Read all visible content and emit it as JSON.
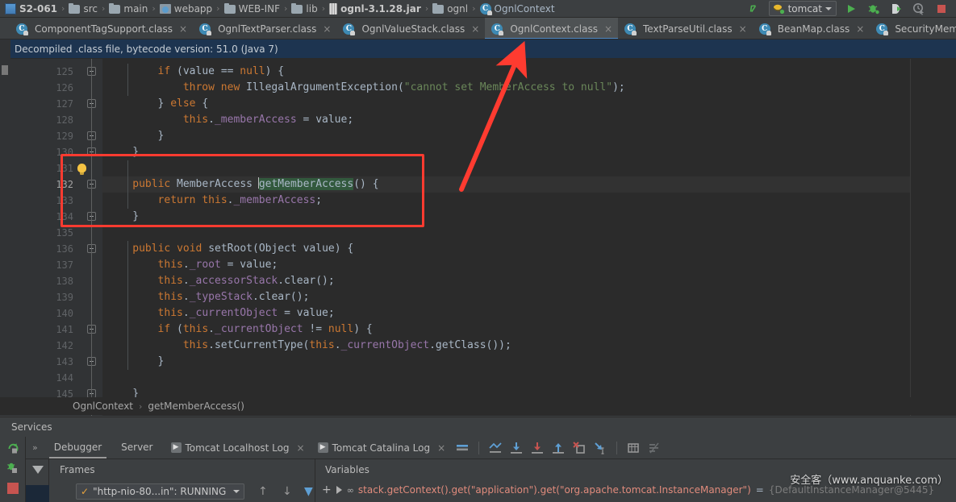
{
  "window": {
    "theme_bg": "#3c3f41",
    "editor_bg": "#2b2b2b",
    "accent": "#4a88c7",
    "annotation_color": "#ff3b30"
  },
  "navbar": {
    "breadcrumbs": [
      {
        "label": "S2-061",
        "icon": "module-icon",
        "bold": true
      },
      {
        "label": "src",
        "icon": "folder-icon",
        "bold": false
      },
      {
        "label": "main",
        "icon": "folder-icon",
        "bold": false
      },
      {
        "label": "webapp",
        "icon": "web-folder-icon",
        "bold": false
      },
      {
        "label": "WEB-INF",
        "icon": "folder-icon",
        "bold": false
      },
      {
        "label": "lib",
        "icon": "folder-icon",
        "bold": false
      },
      {
        "label": "ognl-3.1.28.jar",
        "icon": "jar-icon",
        "bold": true
      },
      {
        "label": "ognl",
        "icon": "folder-icon",
        "bold": false
      },
      {
        "label": "OgnlContext",
        "icon": "class-icon",
        "bold": false
      }
    ],
    "separator": "›",
    "run_config": {
      "name": "tomcat",
      "icon": "tomcat-icon",
      "dropdown": "▾"
    },
    "buttons": [
      {
        "name": "search-everywhere-icon",
        "label": ""
      },
      {
        "name": "run-button",
        "label": ""
      },
      {
        "name": "debug-button",
        "label": ""
      },
      {
        "name": "run-coverage-button",
        "label": ""
      },
      {
        "name": "profiler-button",
        "label": ""
      },
      {
        "name": "stop-button",
        "label": ""
      }
    ]
  },
  "tabs": [
    {
      "label": "ComponentTagSupport.class",
      "icon": "class-icon",
      "active": false,
      "close": "×"
    },
    {
      "label": "OgnlTextParser.class",
      "icon": "class-icon",
      "active": false,
      "close": "×"
    },
    {
      "label": "OgnlValueStack.class",
      "icon": "class-icon",
      "active": false,
      "close": "×"
    },
    {
      "label": "OgnlContext.class",
      "icon": "class-icon",
      "active": true,
      "close": "×"
    },
    {
      "label": "TextParseUtil.class",
      "icon": "class-icon",
      "active": false,
      "close": "×"
    },
    {
      "label": "BeanMap.class",
      "icon": "class-icon",
      "active": false,
      "close": "×"
    },
    {
      "label": "SecurityMemberAccess.c",
      "icon": "class-icon",
      "active": false,
      "close": ""
    }
  ],
  "notification": {
    "text": "Decompiled .class file, bytecode version: 51.0 (Java 7)"
  },
  "editor": {
    "first_line": 125,
    "current_line": 132,
    "selection_text": "getMemberAccess",
    "lines": [
      {
        "n": 125,
        "indent": 2,
        "tokens": [
          {
            "t": "if",
            "c": "kw"
          },
          {
            "t": " (value == ",
            "c": ""
          },
          {
            "t": "null",
            "c": "kw"
          },
          {
            "t": ") {",
            "c": ""
          }
        ]
      },
      {
        "n": 126,
        "indent": 3,
        "tokens": [
          {
            "t": "throw",
            "c": "kw"
          },
          {
            "t": " ",
            "c": ""
          },
          {
            "t": "new",
            "c": "kw"
          },
          {
            "t": " IllegalArgumentException(",
            "c": ""
          },
          {
            "t": "\"cannot set MemberAccess to null\"",
            "c": "str"
          },
          {
            "t": ");",
            "c": ""
          }
        ]
      },
      {
        "n": 127,
        "indent": 2,
        "tokens": [
          {
            "t": "} ",
            "c": ""
          },
          {
            "t": "else",
            "c": "kw"
          },
          {
            "t": " {",
            "c": ""
          }
        ]
      },
      {
        "n": 128,
        "indent": 3,
        "tokens": [
          {
            "t": "this",
            "c": "kw"
          },
          {
            "t": ".",
            "c": ""
          },
          {
            "t": "_memberAccess",
            "c": "fld"
          },
          {
            "t": " = value;",
            "c": ""
          }
        ]
      },
      {
        "n": 129,
        "indent": 2,
        "tokens": [
          {
            "t": "}",
            "c": ""
          }
        ]
      },
      {
        "n": 130,
        "indent": 1,
        "tokens": [
          {
            "t": "}",
            "c": ""
          }
        ]
      },
      {
        "n": 131,
        "indent": 0,
        "tokens": []
      },
      {
        "n": 132,
        "indent": 1,
        "tokens": [
          {
            "t": "public",
            "c": "kw"
          },
          {
            "t": " MemberAccess ",
            "c": ""
          },
          {
            "t": "getMemberAccess",
            "c": "sel"
          },
          {
            "t": "() {",
            "c": ""
          }
        ]
      },
      {
        "n": 133,
        "indent": 2,
        "tokens": [
          {
            "t": "return",
            "c": "kw"
          },
          {
            "t": " ",
            "c": ""
          },
          {
            "t": "this",
            "c": "kw"
          },
          {
            "t": ".",
            "c": ""
          },
          {
            "t": "_memberAccess",
            "c": "fld"
          },
          {
            "t": ";",
            "c": ""
          }
        ]
      },
      {
        "n": 134,
        "indent": 1,
        "tokens": [
          {
            "t": "}",
            "c": ""
          }
        ]
      },
      {
        "n": 135,
        "indent": 0,
        "tokens": []
      },
      {
        "n": 136,
        "indent": 1,
        "tokens": [
          {
            "t": "public",
            "c": "kw"
          },
          {
            "t": " ",
            "c": ""
          },
          {
            "t": "void",
            "c": "kw"
          },
          {
            "t": " setRoot(Object value) {",
            "c": ""
          }
        ]
      },
      {
        "n": 137,
        "indent": 2,
        "tokens": [
          {
            "t": "this",
            "c": "kw"
          },
          {
            "t": ".",
            "c": ""
          },
          {
            "t": "_root",
            "c": "fld"
          },
          {
            "t": " = value;",
            "c": ""
          }
        ]
      },
      {
        "n": 138,
        "indent": 2,
        "tokens": [
          {
            "t": "this",
            "c": "kw"
          },
          {
            "t": ".",
            "c": ""
          },
          {
            "t": "_accessorStack",
            "c": "fld"
          },
          {
            "t": ".clear();",
            "c": ""
          }
        ]
      },
      {
        "n": 139,
        "indent": 2,
        "tokens": [
          {
            "t": "this",
            "c": "kw"
          },
          {
            "t": ".",
            "c": ""
          },
          {
            "t": "_typeStack",
            "c": "fld"
          },
          {
            "t": ".clear();",
            "c": ""
          }
        ]
      },
      {
        "n": 140,
        "indent": 2,
        "tokens": [
          {
            "t": "this",
            "c": "kw"
          },
          {
            "t": ".",
            "c": ""
          },
          {
            "t": "_currentObject",
            "c": "fld"
          },
          {
            "t": " = value;",
            "c": ""
          }
        ]
      },
      {
        "n": 141,
        "indent": 2,
        "tokens": [
          {
            "t": "if",
            "c": "kw"
          },
          {
            "t": " (",
            "c": ""
          },
          {
            "t": "this",
            "c": "kw"
          },
          {
            "t": ".",
            "c": ""
          },
          {
            "t": "_currentObject",
            "c": "fld"
          },
          {
            "t": " != ",
            "c": ""
          },
          {
            "t": "null",
            "c": "kw"
          },
          {
            "t": ") {",
            "c": ""
          }
        ]
      },
      {
        "n": 142,
        "indent": 3,
        "tokens": [
          {
            "t": "this",
            "c": "kw"
          },
          {
            "t": ".setCurrentType(",
            "c": ""
          },
          {
            "t": "this",
            "c": "kw"
          },
          {
            "t": ".",
            "c": ""
          },
          {
            "t": "_currentObject",
            "c": "fld"
          },
          {
            "t": ".getClass());",
            "c": ""
          }
        ]
      },
      {
        "n": 143,
        "indent": 2,
        "tokens": [
          {
            "t": "}",
            "c": ""
          }
        ]
      },
      {
        "n": 144,
        "indent": 0,
        "tokens": []
      },
      {
        "n": 145,
        "indent": 1,
        "tokens": [
          {
            "t": "}",
            "c": ""
          }
        ]
      }
    ],
    "inspection_hint": "lightbulb-icon"
  },
  "editor_breadcrumbs": {
    "items": [
      "OgnlContext",
      "getMemberAccess()"
    ],
    "separator": "›"
  },
  "services": {
    "title": "Services",
    "overflow": "»",
    "tabs": [
      {
        "label": "Debugger",
        "active": true
      },
      {
        "label": "Server",
        "active": false
      }
    ],
    "log_tabs": [
      {
        "label": "Tomcat Localhost Log",
        "close": "×"
      },
      {
        "label": "Tomcat Catalina Log",
        "close": "×"
      }
    ],
    "toolbar_icons": [
      "layout-settings-icon",
      "show-execution-point-icon",
      "step-over-icon",
      "step-into-icon",
      "step-out-icon",
      "force-step-into-icon",
      "run-to-cursor-icon",
      "evaluate-expression-icon",
      "mute-breakpoints-icon"
    ],
    "left_strip_icons": [
      "rerun-icon",
      "debug-icon",
      "stop-icon"
    ]
  },
  "debugger": {
    "frames": {
      "header": "Frames",
      "thread": "\"http-nio-80...in\": RUNNING",
      "thread_state_icon": "check-icon",
      "dropdown": "▾",
      "buttons": [
        "up-arrow-icon",
        "down-arrow-icon",
        "filter-icon"
      ]
    },
    "variables": {
      "header": "Variables",
      "add_label": "+",
      "rows": [
        {
          "expression": "stack.getContext().get(\"application\").get(\"org.apache.tomcat.InstanceManager\")",
          "equals": " = ",
          "value": "{DefaultInstanceManager@5445}",
          "icon": "watch-icon"
        }
      ]
    }
  },
  "watermark": {
    "text": "安全客（www.anquanke.com）"
  }
}
